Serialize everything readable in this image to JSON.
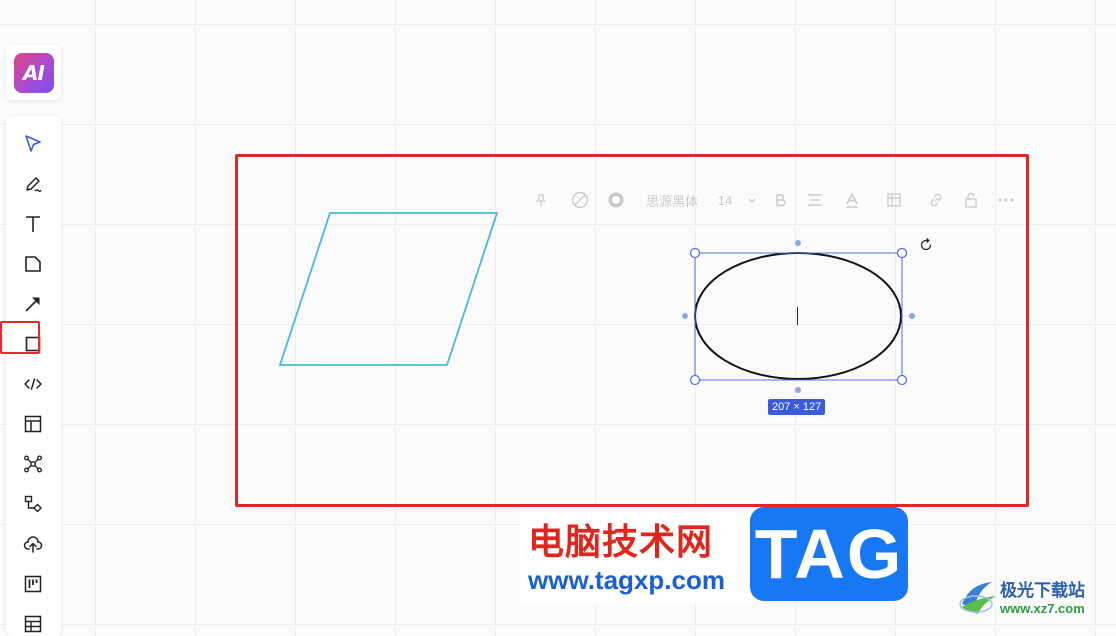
{
  "ai_button": {
    "label": "AI",
    "gradient_start": "#e0448a",
    "gradient_end": "#7c4ee8"
  },
  "toolbar": {
    "tools": [
      {
        "name": "select-tool",
        "icon": "cursor-arrow-icon"
      },
      {
        "name": "pen-tool",
        "icon": "pen-icon"
      },
      {
        "name": "text-tool",
        "icon": "text-t-icon"
      },
      {
        "name": "sticky-note-tool",
        "icon": "sticky-note-icon"
      },
      {
        "name": "arrow-tool",
        "icon": "arrow-line-icon"
      },
      {
        "name": "shape-tool",
        "icon": "square-shape-icon"
      },
      {
        "name": "code-block-tool",
        "icon": "code-brackets-icon"
      },
      {
        "name": "layout-frame-tool",
        "icon": "frame-layout-icon"
      },
      {
        "name": "mind-map-tool",
        "icon": "mind-map-icon"
      },
      {
        "name": "flowchart-tool",
        "icon": "flowchart-icon"
      },
      {
        "name": "upload-tool",
        "icon": "cloud-upload-icon"
      },
      {
        "name": "kanban-tool",
        "icon": "kanban-icon"
      },
      {
        "name": "table-tool",
        "icon": "table-icon"
      }
    ],
    "highlight_color": "#e12b2b"
  },
  "format_toolbar": {
    "font_name": "思源黑体",
    "font_size": "14"
  },
  "canvas": {
    "parallelogram_stroke": "#4ab8d6",
    "ellipse_stroke": "#111111",
    "selection_color": "#4f6fe0",
    "selection_size": "207 × 127",
    "annotation_color": "#dc2a2a"
  },
  "watermark": {
    "cn_text": "电脑技术网",
    "url": "www.tagxp.com",
    "tag": "TAG"
  },
  "site_logo": {
    "name": "极光下载站",
    "url": "www.xz7.com"
  }
}
